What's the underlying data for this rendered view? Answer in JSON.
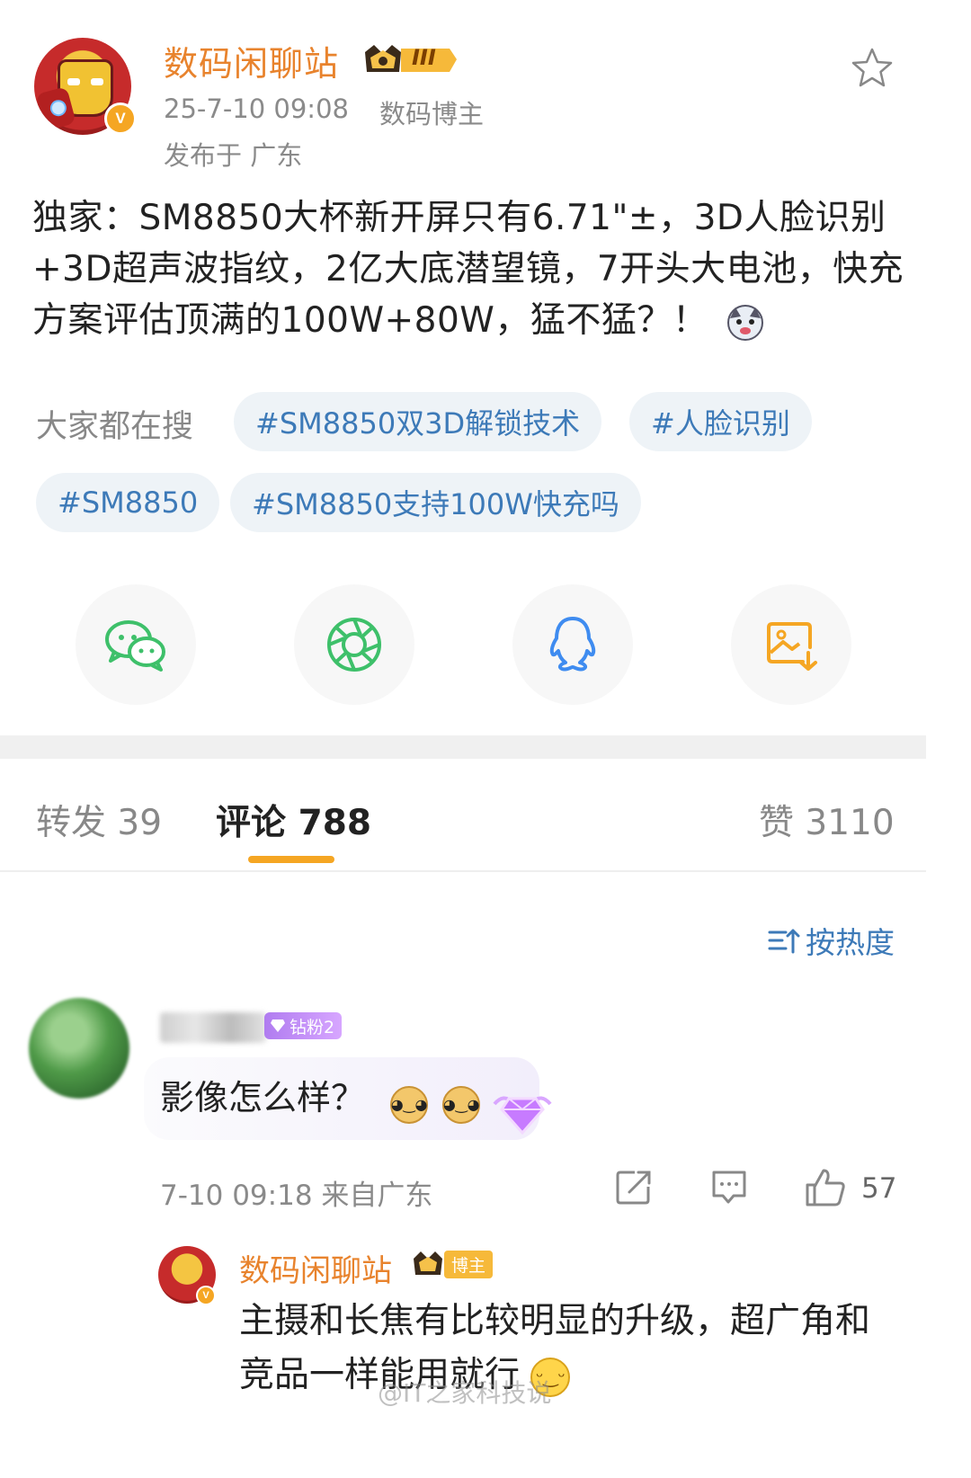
{
  "post": {
    "author": "数码闲聊站",
    "level_badge": "III",
    "time": "25-7-10 09:08",
    "role": "数码博主",
    "location": "发布于 广东",
    "text": "独家：SM8850大杯新开屏只有6.71\"±，3D人脸识别+3D超声波指纹，2亿大底潜望镜，7开头大电池，快充方案评估顶满的100W+80W，猛不猛？！",
    "emoji": "husky-emoji"
  },
  "hot_search": {
    "label": "大家都在搜",
    "chips": [
      "#SM8850双3D解锁技术",
      "#人脸识别",
      "#SM8850",
      "#SM8850支持100W快充吗"
    ]
  },
  "share": {
    "items": [
      "wechat-icon",
      "moments-icon",
      "qq-icon",
      "save-image-icon"
    ]
  },
  "tabs": {
    "repost": "转发 39",
    "comments": "评论 788",
    "likes": "赞 3110"
  },
  "sort": {
    "label": "按热度"
  },
  "comment": {
    "badge": "钻粉2",
    "text": "影像怎么样？",
    "time_location": "7-10 09:18 来自广东",
    "like_count": "57"
  },
  "reply": {
    "author": "数码闲聊站",
    "badge": "博主",
    "text": "主摄和长焦有比较明显的升级，超广角和竞品一样能用就行"
  },
  "watermark": "@IT之家科技说",
  "colors": {
    "author_orange": "#e8832d",
    "link_blue": "#3d7ab8",
    "tab_accent": "#f5a623",
    "wechat_green": "#3ec06a",
    "qq_blue": "#3f8cf0",
    "save_orange": "#f5a623"
  }
}
